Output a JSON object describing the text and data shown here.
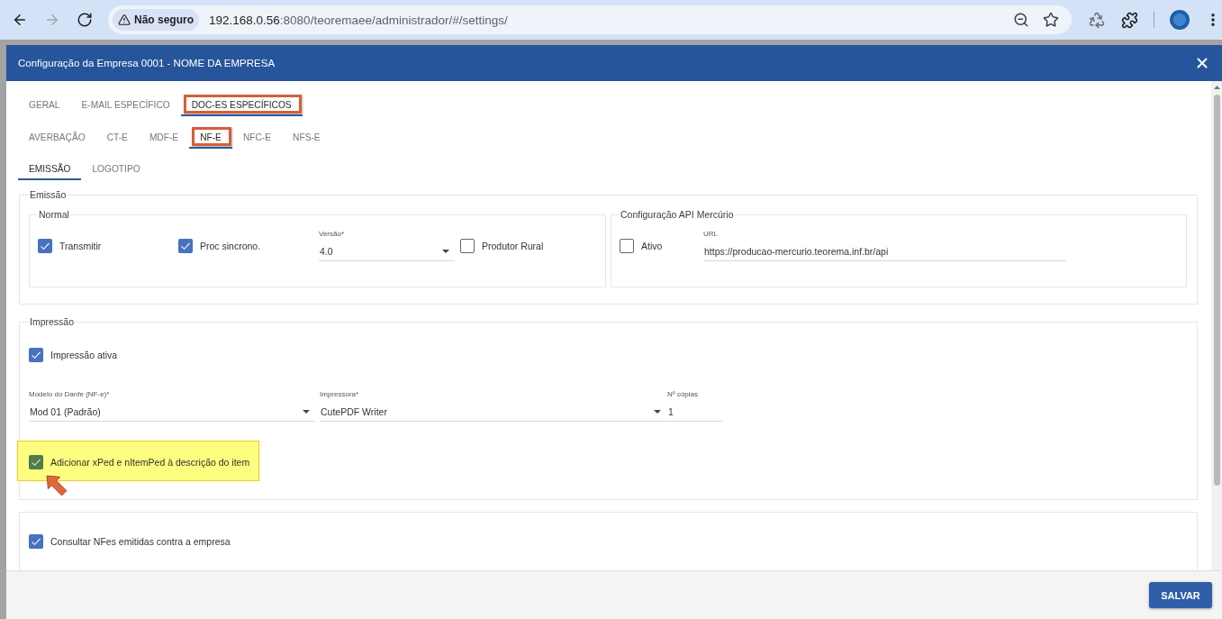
{
  "browser": {
    "nav": [
      {
        "kind": "back",
        "disabled": false
      },
      {
        "kind": "forward",
        "disabled": true
      },
      {
        "kind": "reload",
        "disabled": false
      }
    ],
    "security_chip": "Não seguro",
    "url": {
      "host": "192.168.0.56",
      "path": ":8080/teoremaee/administrador/#/settings/"
    }
  },
  "dialog": {
    "title": "Configuração da Empresa 0001 - NOME DA EMPRESA",
    "section_tabs": [
      {
        "label": "GERAL",
        "selected": false,
        "highlighted": false
      },
      {
        "label": "E-MAIL ESPECÍFICO",
        "selected": false,
        "highlighted": false
      },
      {
        "label": "DOC-ES ESPECÍFICOS",
        "selected": true,
        "highlighted": true
      }
    ],
    "document_tabs": [
      {
        "label": "AVERBAÇÃO",
        "selected": false,
        "highlighted": false
      },
      {
        "label": "CT-E",
        "selected": false,
        "highlighted": false
      },
      {
        "label": "MDF-E",
        "selected": false,
        "highlighted": false
      },
      {
        "label": "NF-E",
        "selected": true,
        "highlighted": true
      },
      {
        "label": "NFC-E",
        "selected": false,
        "highlighted": false
      },
      {
        "label": "NFS-E",
        "selected": false,
        "highlighted": false
      }
    ],
    "nfe_tabs": [
      {
        "label": "EMISSÃO",
        "selected": true,
        "highlighted": false
      },
      {
        "label": "LOGOTIPO",
        "selected": false,
        "highlighted": false
      }
    ],
    "emission": {
      "legend": "Emissão",
      "groups": [
        {
          "legend": "Normal",
          "fields": [
            {
              "kind": "checkbox",
              "label": "Transmitir",
              "checked": true
            },
            {
              "kind": "checkbox",
              "label": "Proc sincrono.",
              "checked": true
            },
            {
              "kind": "select",
              "label": "Versão*",
              "value": "4.0"
            },
            {
              "kind": "checkbox",
              "label": "Produtor Rural",
              "checked": false
            }
          ]
        },
        {
          "legend": "Configuração API Mercúrio",
          "fields": [
            {
              "kind": "checkbox",
              "label": "Ativo",
              "checked": false
            },
            {
              "kind": "text",
              "label": "URL",
              "value": "https://producao-mercurio.teorema.inf.br/api"
            }
          ]
        }
      ]
    },
    "printing": {
      "legend": "Impressão",
      "active": {
        "label": "Impressão ativa",
        "checked": true
      },
      "fields": [
        {
          "kind": "select",
          "label": "Modelo do Danfe (NF-e)*",
          "value": "Mod 01 (Padrão)"
        },
        {
          "kind": "select",
          "label": "Impressora*",
          "value": "CutePDF Writer"
        },
        {
          "kind": "text",
          "label": "Nº cópias",
          "value": "1"
        }
      ],
      "item_description": {
        "label": "Adicionar xPed e nItemPed à descrição do item",
        "checked": true,
        "highlighted": true
      }
    },
    "consultation": {
      "label": "Consultar NFes emitidas contra a empresa",
      "checked": true
    },
    "save_button": "SALVAR"
  }
}
